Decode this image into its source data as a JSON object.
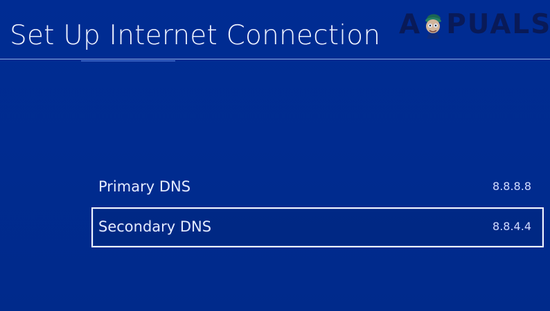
{
  "header": {
    "title": "Set Up Internet Connection"
  },
  "watermark": {
    "brand_a": "A",
    "brand_rest": "PUALS",
    "icon": "appuals-mascot-icon"
  },
  "dns_settings": {
    "items": [
      {
        "label": "Primary DNS",
        "value": "8.8.8.8",
        "selected": false
      },
      {
        "label": "Secondary DNS",
        "value": "8.8.4.4",
        "selected": true
      }
    ]
  },
  "colors": {
    "background": "#002b8f",
    "text": "#ffffff",
    "selection_border": "#f3f6ff"
  }
}
